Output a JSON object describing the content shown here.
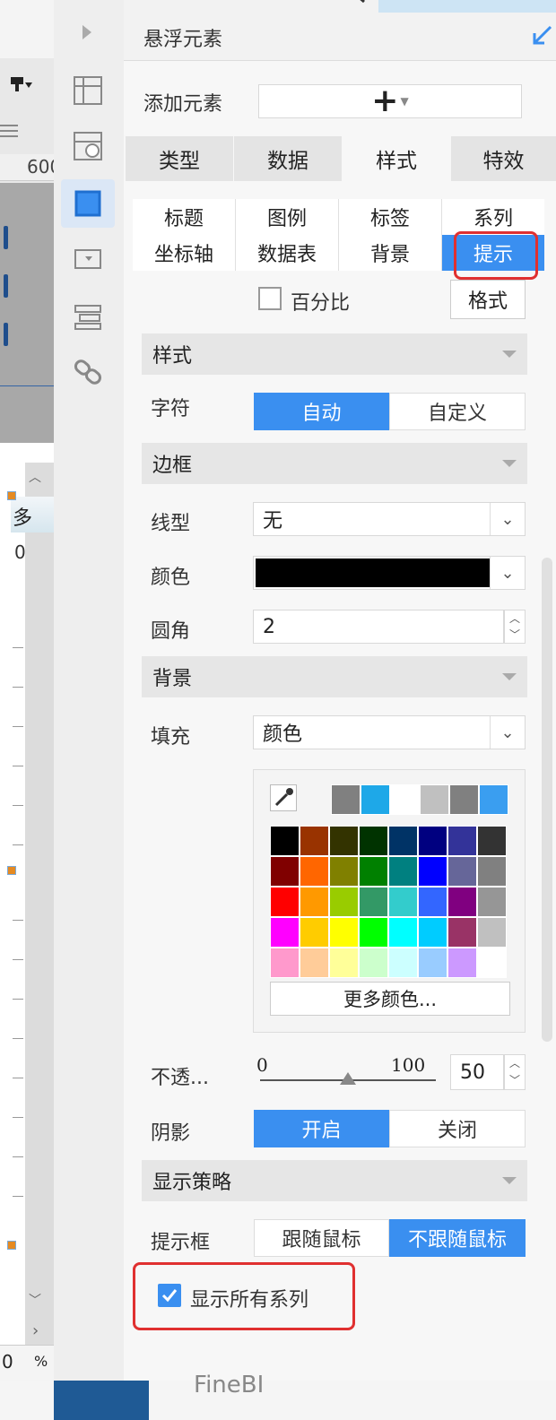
{
  "panel": {
    "title": "悬浮元素",
    "add_element_label": "添加元素",
    "add_button_glyph": "+"
  },
  "left_strip": {
    "ruler_value": "600",
    "cell_text_1": "多",
    "cell_text_2": "0",
    "bottom_value": "0",
    "bottom_unit": "%"
  },
  "main_tabs": [
    {
      "label": "类型",
      "active": false
    },
    {
      "label": "数据",
      "active": false
    },
    {
      "label": "样式",
      "active": true
    },
    {
      "label": "特效",
      "active": false
    }
  ],
  "sub_tabs": [
    {
      "label": "标题",
      "active": false
    },
    {
      "label": "图例",
      "active": false
    },
    {
      "label": "标签",
      "active": false
    },
    {
      "label": "系列",
      "active": false
    },
    {
      "label": "坐标轴",
      "active": false
    },
    {
      "label": "数据表",
      "active": false
    },
    {
      "label": "背景",
      "active": false
    },
    {
      "label": "提示",
      "active": true
    }
  ],
  "percent": {
    "label": "百分比",
    "checked": false
  },
  "format_button": "格式",
  "sections": {
    "style": "样式",
    "border": "边框",
    "background": "背景",
    "strategy": "显示策略"
  },
  "char": {
    "label": "字符",
    "options": [
      "自动",
      "自定义"
    ],
    "selected": "自动"
  },
  "line_type": {
    "label": "线型",
    "value": "无"
  },
  "color": {
    "label": "颜色",
    "value_hex": "#000000"
  },
  "corner": {
    "label": "圆角",
    "value": "2"
  },
  "fill": {
    "label": "填充",
    "value": "颜色"
  },
  "palette": {
    "recent": [
      "#808080",
      "#1ea8e8",
      "#ffffff",
      "#c0c0c0",
      "#808080",
      "#3a9ef0"
    ],
    "grid": [
      [
        "#000000",
        "#993300",
        "#333300",
        "#003300",
        "#003366",
        "#000080",
        "#333399",
        "#333333"
      ],
      [
        "#800000",
        "#ff6600",
        "#808000",
        "#008000",
        "#008080",
        "#0000ff",
        "#666699",
        "#808080"
      ],
      [
        "#ff0000",
        "#ff9900",
        "#99cc00",
        "#339966",
        "#33cccc",
        "#3366ff",
        "#800080",
        "#969696"
      ],
      [
        "#ff00ff",
        "#ffcc00",
        "#ffff00",
        "#00ff00",
        "#00ffff",
        "#00ccff",
        "#993366",
        "#c0c0c0"
      ],
      [
        "#ff99cc",
        "#ffcc99",
        "#ffff99",
        "#ccffcc",
        "#ccffff",
        "#99ccff",
        "#cc99ff",
        "#ffffff"
      ]
    ],
    "more_label": "更多颜色..."
  },
  "opacity": {
    "label": "不透...",
    "min_label": "0",
    "max_label": "100",
    "value": "50",
    "fraction": 0.5
  },
  "shadow": {
    "label": "阴影",
    "options": [
      "开启",
      "关闭"
    ],
    "selected": "开启"
  },
  "tooltip_box": {
    "label": "提示框",
    "options": [
      "跟随鼠标",
      "不跟随鼠标"
    ],
    "selected": "不跟随鼠标"
  },
  "show_all_series": {
    "label": "显示所有系列",
    "checked": true
  },
  "footer_text": "FineBI",
  "colors": {
    "accent": "#3a8ff0",
    "highlight": "#e03030"
  }
}
